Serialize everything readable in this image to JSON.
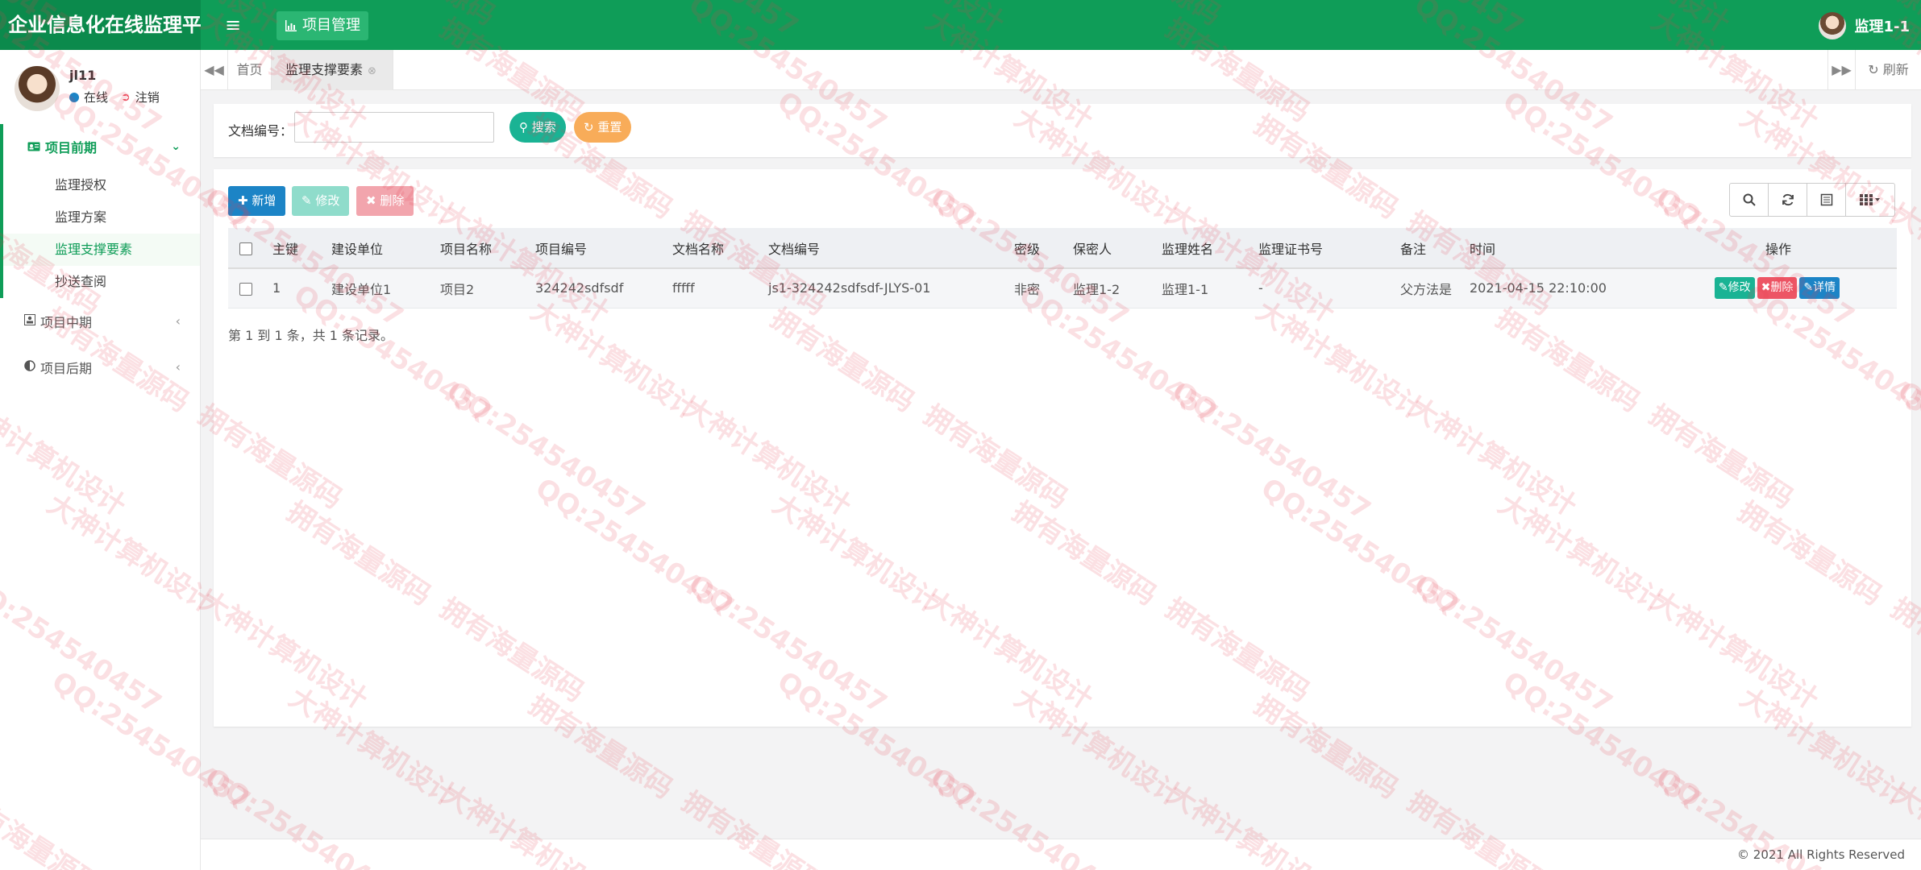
{
  "app": {
    "title": "企业信息化在线监理平台"
  },
  "topnav": {
    "menu_icon": "hamburger-icon",
    "module": "项目管理",
    "module_icon": "bar-chart-icon",
    "user": "监理1-1"
  },
  "sidebar": {
    "user": {
      "name": "jl11",
      "status": "在线",
      "logout": "注销"
    },
    "groups": [
      {
        "label": "项目前期",
        "icon": "id-card-icon",
        "expanded": true,
        "items": [
          "监理授权",
          "监理方案",
          "监理支撑要素",
          "抄送查阅"
        ],
        "current": "监理支撑要素"
      },
      {
        "label": "项目中期",
        "icon": "user-box-icon",
        "expanded": false
      },
      {
        "label": "项目后期",
        "icon": "half-circle-icon",
        "expanded": false
      }
    ]
  },
  "tabs": {
    "home": "首页",
    "active": "监理支撑要素",
    "refresh": "刷新"
  },
  "search": {
    "label": "文档编号：",
    "value": "",
    "placeholder": "",
    "search_btn": "搜索",
    "reset_btn": "重置"
  },
  "toolbar": {
    "add": "新增",
    "edit": "修改",
    "delete": "删除"
  },
  "table": {
    "columns": [
      "主键",
      "建设单位",
      "项目名称",
      "项目编号",
      "文档名称",
      "文档编号",
      "密级",
      "保密人",
      "监理姓名",
      "监理证书号",
      "备注",
      "时间",
      "操作"
    ],
    "rows": [
      {
        "id": "1",
        "unit": "建设单位1",
        "project": "项目2",
        "project_no": "324242sdfsdf",
        "doc_name": "fffff",
        "doc_no": "js1-324242sdfsdf-JLYS-01",
        "secret": "非密",
        "keeper": "监理1-2",
        "supervisor": "监理1-1",
        "cert": "-",
        "remark": "父方法是",
        "time": "2021-04-15 22:10:00",
        "ops": {
          "edit": "修改",
          "delete": "删除",
          "detail": "详情"
        }
      }
    ]
  },
  "pager": {
    "summary": "第 1 到 1 条，共 1 条记录。"
  },
  "footer": {
    "copyright": "© 2021 All Rights Reserved"
  },
  "watermark": {
    "texts": [
      "QQ:254540457",
      "大神计算机设计",
      "拥有海量源码"
    ]
  },
  "colors": {
    "brand": "#0f9d58",
    "primary": "#1c84c6",
    "success": "#1ab394",
    "warning": "#f8ac59",
    "danger": "#ed5565"
  }
}
